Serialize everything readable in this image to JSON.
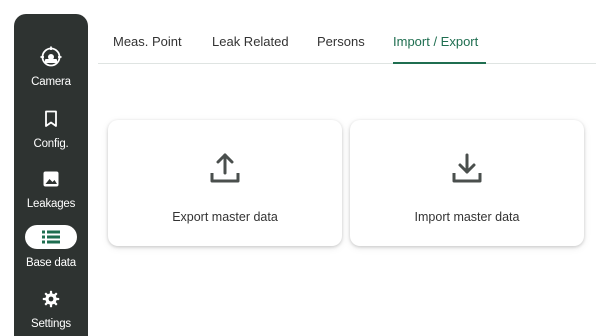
{
  "sidebar": {
    "items": [
      {
        "label": "Camera",
        "icon": "camera-icon",
        "active": false
      },
      {
        "label": "Config.",
        "icon": "bookmark-icon",
        "active": false
      },
      {
        "label": "Leakages",
        "icon": "image-icon",
        "active": false
      },
      {
        "label": "Base data",
        "icon": "list-icon",
        "active": true
      },
      {
        "label": "Settings",
        "icon": "gear-icon",
        "active": false
      }
    ]
  },
  "tabs": [
    {
      "label": "Meas. Point",
      "active": false
    },
    {
      "label": "Leak Related",
      "active": false
    },
    {
      "label": "Persons",
      "active": false
    },
    {
      "label": "Import / Export",
      "active": true
    }
  ],
  "cards": {
    "export": {
      "label": "Export master data",
      "icon": "upload-icon"
    },
    "import": {
      "label": "Import master data",
      "icon": "download-icon"
    }
  },
  "colors": {
    "sidebar_bg": "#2e3331",
    "accent": "#1f6e50",
    "icon_gray": "#4a4f4d"
  }
}
